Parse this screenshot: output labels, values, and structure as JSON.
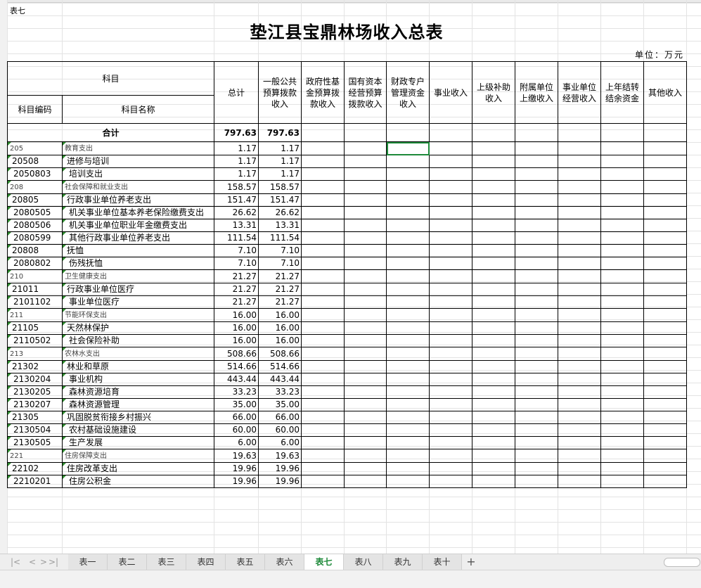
{
  "sheet": {
    "table_no": "表七",
    "title": "垫江县宝鼎林场收入总表",
    "unit": "单位：万元"
  },
  "headers": {
    "subject": "科目",
    "subject_code": "科目编码",
    "subject_name": "科目名称",
    "total": "总计",
    "general_budget": "一般公共预算拨款收入",
    "gov_fund": "政府性基金预算拨款收入",
    "state_capital": "国有资本经营预算拨款收入",
    "special_fund": "财政专户管理资金收入",
    "business_income": "事业收入",
    "subsidy": "上级补助收入",
    "affiliated": "附属单位上缴收入",
    "operating": "事业单位经营收入",
    "carryover": "上年结转结余资金",
    "other": "其他收入"
  },
  "sum_row": {
    "label": "合计",
    "total": "797.63",
    "general": "797.63"
  },
  "rows": [
    {
      "code": "205",
      "name": "教育支出",
      "total": "1.17",
      "general": "1.17",
      "level": 1
    },
    {
      "code": "20508",
      "name": "进修与培训",
      "total": "1.17",
      "general": "1.17",
      "level": 2
    },
    {
      "code": "2050803",
      "name": "培训支出",
      "total": "1.17",
      "general": "1.17",
      "level": 3
    },
    {
      "code": "208",
      "name": "社会保障和就业支出",
      "total": "158.57",
      "general": "158.57",
      "level": 1
    },
    {
      "code": "20805",
      "name": "行政事业单位养老支出",
      "total": "151.47",
      "general": "151.47",
      "level": 2
    },
    {
      "code": "2080505",
      "name": "机关事业单位基本养老保险缴费支出",
      "total": "26.62",
      "general": "26.62",
      "level": 3
    },
    {
      "code": "2080506",
      "name": "机关事业单位职业年金缴费支出",
      "total": "13.31",
      "general": "13.31",
      "level": 3
    },
    {
      "code": "2080599",
      "name": "其他行政事业单位养老支出",
      "total": "111.54",
      "general": "111.54",
      "level": 3
    },
    {
      "code": "20808",
      "name": "抚恤",
      "total": "7.10",
      "general": "7.10",
      "level": 2
    },
    {
      "code": "2080802",
      "name": "伤残抚恤",
      "total": "7.10",
      "general": "7.10",
      "level": 3
    },
    {
      "code": "210",
      "name": "卫生健康支出",
      "total": "21.27",
      "general": "21.27",
      "level": 1
    },
    {
      "code": "21011",
      "name": "行政事业单位医疗",
      "total": "21.27",
      "general": "21.27",
      "level": 2
    },
    {
      "code": "2101102",
      "name": "事业单位医疗",
      "total": "21.27",
      "general": "21.27",
      "level": 3
    },
    {
      "code": "211",
      "name": "节能环保支出",
      "total": "16.00",
      "general": "16.00",
      "level": 1
    },
    {
      "code": "21105",
      "name": "天然林保护",
      "total": "16.00",
      "general": "16.00",
      "level": 2
    },
    {
      "code": "2110502",
      "name": "社会保险补助",
      "total": "16.00",
      "general": "16.00",
      "level": 3
    },
    {
      "code": "213",
      "name": "农林水支出",
      "total": "508.66",
      "general": "508.66",
      "level": 1
    },
    {
      "code": "21302",
      "name": "林业和草原",
      "total": "514.66",
      "general": "514.66",
      "level": 2
    },
    {
      "code": "2130204",
      "name": "事业机构",
      "total": "443.44",
      "general": "443.44",
      "level": 3
    },
    {
      "code": "2130205",
      "name": "森林资源培育",
      "total": "33.23",
      "general": "33.23",
      "level": 3
    },
    {
      "code": "2130207",
      "name": "森林资源管理",
      "total": "35.00",
      "general": "35.00",
      "level": 3
    },
    {
      "code": "21305",
      "name": "巩固脱贫衔接乡村振兴",
      "total": "66.00",
      "general": "66.00",
      "level": 2
    },
    {
      "code": "2130504",
      "name": "农村基础设施建设",
      "total": "60.00",
      "general": "60.00",
      "level": 3
    },
    {
      "code": "2130505",
      "name": "生产发展",
      "total": "6.00",
      "general": "6.00",
      "level": 3
    },
    {
      "code": "221",
      "name": "住房保障支出",
      "total": "19.63",
      "general": "19.63",
      "level": 1
    },
    {
      "code": "22102",
      "name": "住房改革支出",
      "total": "19.96",
      "general": "19.96",
      "level": 2
    },
    {
      "code": "2210201",
      "name": "住房公积金",
      "total": "19.96",
      "general": "19.96",
      "level": 3
    }
  ],
  "tabs": [
    {
      "label": "表一",
      "active": false
    },
    {
      "label": "表二",
      "active": false
    },
    {
      "label": "表三",
      "active": false
    },
    {
      "label": "表四",
      "active": false
    },
    {
      "label": "表五",
      "active": false
    },
    {
      "label": "表六",
      "active": false
    },
    {
      "label": "表七",
      "active": true
    },
    {
      "label": "表八",
      "active": false
    },
    {
      "label": "表九",
      "active": false
    },
    {
      "label": "表十",
      "active": false
    }
  ],
  "tab_nav": {
    "add": "+",
    "first": "|<",
    "prev": "<",
    "next": ">",
    "last": ">|"
  },
  "colors": {
    "accent": "#1e8a3a",
    "marker": "#2e8b2e"
  }
}
